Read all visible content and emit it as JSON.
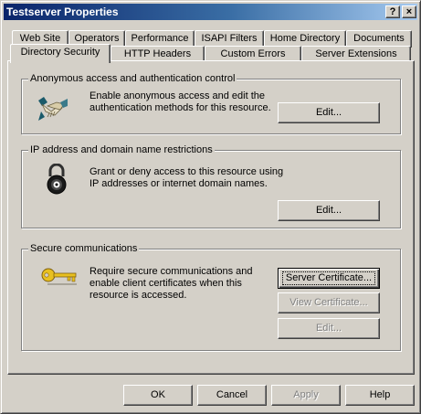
{
  "window": {
    "title": "Testserver Properties",
    "help_button": "?",
    "close_button": "×"
  },
  "tabs": {
    "row_back": [
      "Web Site",
      "Operators",
      "Performance",
      "ISAPI Filters",
      "Home Directory",
      "Documents"
    ],
    "row_front": [
      "Directory Security",
      "HTTP Headers",
      "Custom Errors",
      "Server Extensions"
    ],
    "selected": "Directory Security"
  },
  "anonymous_group": {
    "label": "Anonymous access and authentication control",
    "description": "Enable anonymous access and edit the\nauthentication methods for this resource.",
    "edit_button": "Edit...",
    "icon": "handshake-icon"
  },
  "ip_group": {
    "label": "IP address and domain name restrictions",
    "description": "Grant or deny access to this resource using\nIP addresses or internet domain names.",
    "edit_button": "Edit...",
    "icon": "padlock-icon"
  },
  "secure_group": {
    "label": "Secure communications",
    "description": "Require secure communications and\nenable client certificates when this\nresource is accessed.",
    "server_certificate_button": "Server Certificate...",
    "view_certificate_button": "View Certificate...",
    "edit_button": "Edit...",
    "icon": "key-icon"
  },
  "footer": {
    "ok": "OK",
    "cancel": "Cancel",
    "apply": "Apply",
    "help": "Help"
  },
  "colors": {
    "face": "#d4d0c8",
    "title_start": "#0a246a",
    "title_end": "#a6caf0",
    "disabled_text": "#808080"
  }
}
